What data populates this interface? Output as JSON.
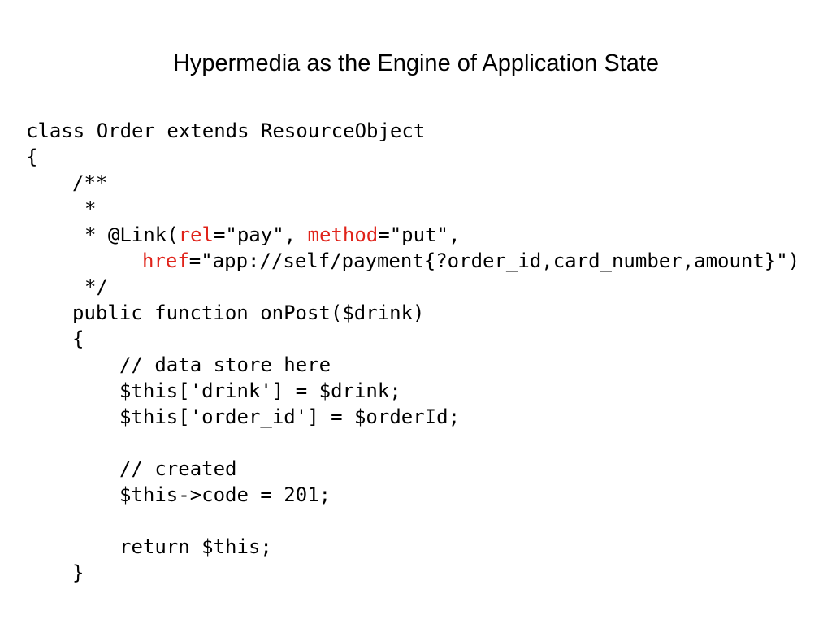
{
  "slide": {
    "title": "Hypermedia as the Engine of Application State"
  },
  "code": {
    "line_class": "class Order extends ResourceObject",
    "line_open_brace": "{",
    "line_doc_open": "/**",
    "line_doc_star": "*",
    "line_link_prefix": "* @Link(",
    "attr_rel": "rel",
    "line_link_rel_value": "=\"pay\", ",
    "attr_method": "method",
    "line_link_method_value": "=\"put\",",
    "attr_href": "href",
    "line_link_href_value": "=\"app://self/payment{?order_id,card_number,amount}\")",
    "line_doc_close": "*/",
    "line_function": "public function onPost($drink)",
    "line_fn_open_brace": "{",
    "line_comment_store": "// data store here",
    "line_assign_drink": "$this['drink'] = $drink;",
    "line_assign_order": "$this['order_id'] = $orderId;",
    "line_comment_created": "// created",
    "line_code_201": "$this->code = 201;",
    "line_return": "return $this;",
    "line_fn_close_brace": "}"
  },
  "colors": {
    "background": "#ffffff",
    "text": "#000000",
    "annotation_attribute": "#e0231a"
  }
}
